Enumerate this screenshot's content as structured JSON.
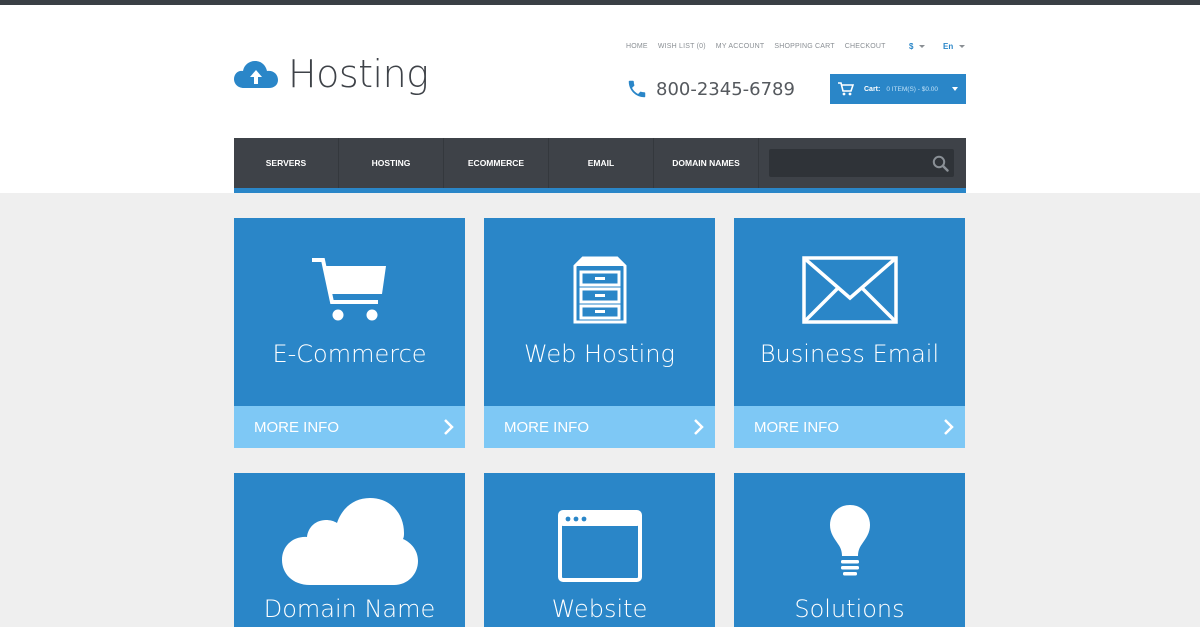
{
  "brand": {
    "name": "Hosting",
    "logo_icon": "cloud-upload-icon"
  },
  "top_links": [
    "HOME",
    "WISH LIST (0)",
    "MY ACCOUNT",
    "SHOPPING CART",
    "CHECKOUT"
  ],
  "currency": {
    "selected": "$"
  },
  "language": {
    "selected": "En"
  },
  "phone": {
    "number": "800-2345-6789",
    "icon": "phone-icon"
  },
  "cart": {
    "label": "Cart:",
    "value": "0 ITEM(S) - $0.00",
    "icon": "cart-icon"
  },
  "nav": {
    "items": [
      "SERVERS",
      "HOSTING",
      "ECOMMERCE",
      "EMAIL",
      "DOMAIN NAMES"
    ],
    "search": {
      "placeholder": "",
      "icon": "search-icon"
    }
  },
  "tiles": [
    {
      "title": "E-Commerce",
      "more": "MORE INFO",
      "icon": "shopping-cart-icon"
    },
    {
      "title": "Web Hosting",
      "more": "MORE INFO",
      "icon": "server-cabinet-icon"
    },
    {
      "title": "Business Email",
      "more": "MORE INFO",
      "icon": "envelope-icon"
    },
    {
      "title": "Domain Name",
      "icon": "cloud-icon"
    },
    {
      "title": "Website",
      "icon": "browser-window-icon"
    },
    {
      "title": "Solutions",
      "icon": "lightbulb-icon"
    }
  ],
  "colors": {
    "primary": "#2a86c8",
    "light": "#7ec8f5",
    "dark": "#3e4248",
    "background": "#efefef"
  }
}
